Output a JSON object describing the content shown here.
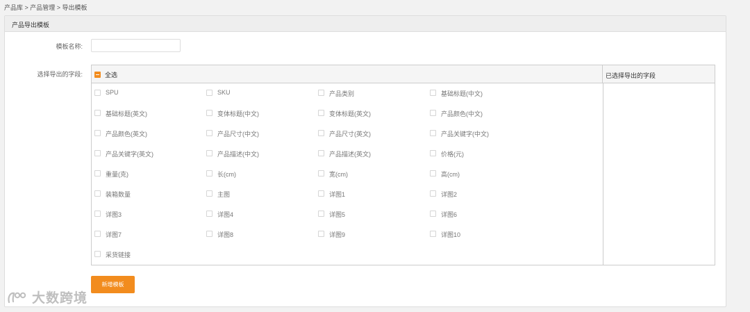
{
  "breadcrumb": "产品库 > 产品管理 > 导出模板",
  "panel": {
    "title": "产品导出模板"
  },
  "form": {
    "name_label": "模板名称:",
    "name_value": "",
    "fields_label": "选择导出的字段:",
    "select_all": "全选",
    "selected_header": "已选择导出的字段",
    "fields": [
      "SPU",
      "SKU",
      "产品类别",
      "基础标题(中文)",
      "基础标题(英文)",
      "变体标题(中文)",
      "变体标题(英文)",
      "产品颜色(中文)",
      "产品颜色(英文)",
      "产品尺寸(中文)",
      "产品尺寸(英文)",
      "产品关键字(中文)",
      "产品关键字(英文)",
      "产品描述(中文)",
      "产品描述(英文)",
      "价格(元)",
      "重量(克)",
      "长(cm)",
      "宽(cm)",
      "高(cm)",
      "装箱数量",
      "主图",
      "详图1",
      "详图2",
      "详图3",
      "详图4",
      "详图5",
      "详图6",
      "详图7",
      "详图8",
      "详图9",
      "详图10",
      "采货链接"
    ],
    "add_button": "新增模板"
  },
  "watermark": {
    "text": "大数跨境",
    "icon": "brand-logo-icon"
  },
  "colors": {
    "accent": "#f28c1e",
    "header_bg": "#eeeeee",
    "border": "#cccccc"
  }
}
